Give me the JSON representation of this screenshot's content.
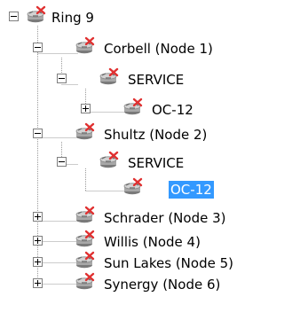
{
  "tree": {
    "nodes": [
      {
        "label": "Ring 9",
        "icon": "network-node-error-icon",
        "expander": "minus",
        "selected": false
      },
      {
        "label": "Corbell (Node 1)",
        "icon": "network-node-error-icon",
        "expander": "minus",
        "selected": false
      },
      {
        "label": "SERVICE",
        "icon": "network-node-error-icon",
        "expander": "minus",
        "selected": false
      },
      {
        "label": "OC-12",
        "icon": "network-node-error-icon",
        "expander": "plus",
        "selected": false
      },
      {
        "label": "Shultz (Node 2)",
        "icon": "network-node-error-icon",
        "expander": "minus",
        "selected": false
      },
      {
        "label": "SERVICE",
        "icon": "network-node-error-icon",
        "expander": "minus",
        "selected": false
      },
      {
        "label": "OC-12",
        "icon": "network-node-error-icon",
        "expander": "none",
        "selected": true
      },
      {
        "label": "Schrader (Node 3)",
        "icon": "network-node-error-icon",
        "expander": "plus",
        "selected": false
      },
      {
        "label": "Willis (Node 4)",
        "icon": "network-node-error-icon",
        "expander": "plus",
        "selected": false
      },
      {
        "label": "Sun Lakes (Node 5)",
        "icon": "network-node-error-icon",
        "expander": "plus",
        "selected": false
      },
      {
        "label": "Synergy (Node 6)",
        "icon": "network-node-error-icon",
        "expander": "plus",
        "selected": false
      }
    ]
  },
  "colors": {
    "selection": "#3399ff",
    "selection_text": "#ffffff",
    "error_mark": "#e03030",
    "icon_body": "#a8a8a8",
    "guide_line": "#9a9a9a"
  }
}
